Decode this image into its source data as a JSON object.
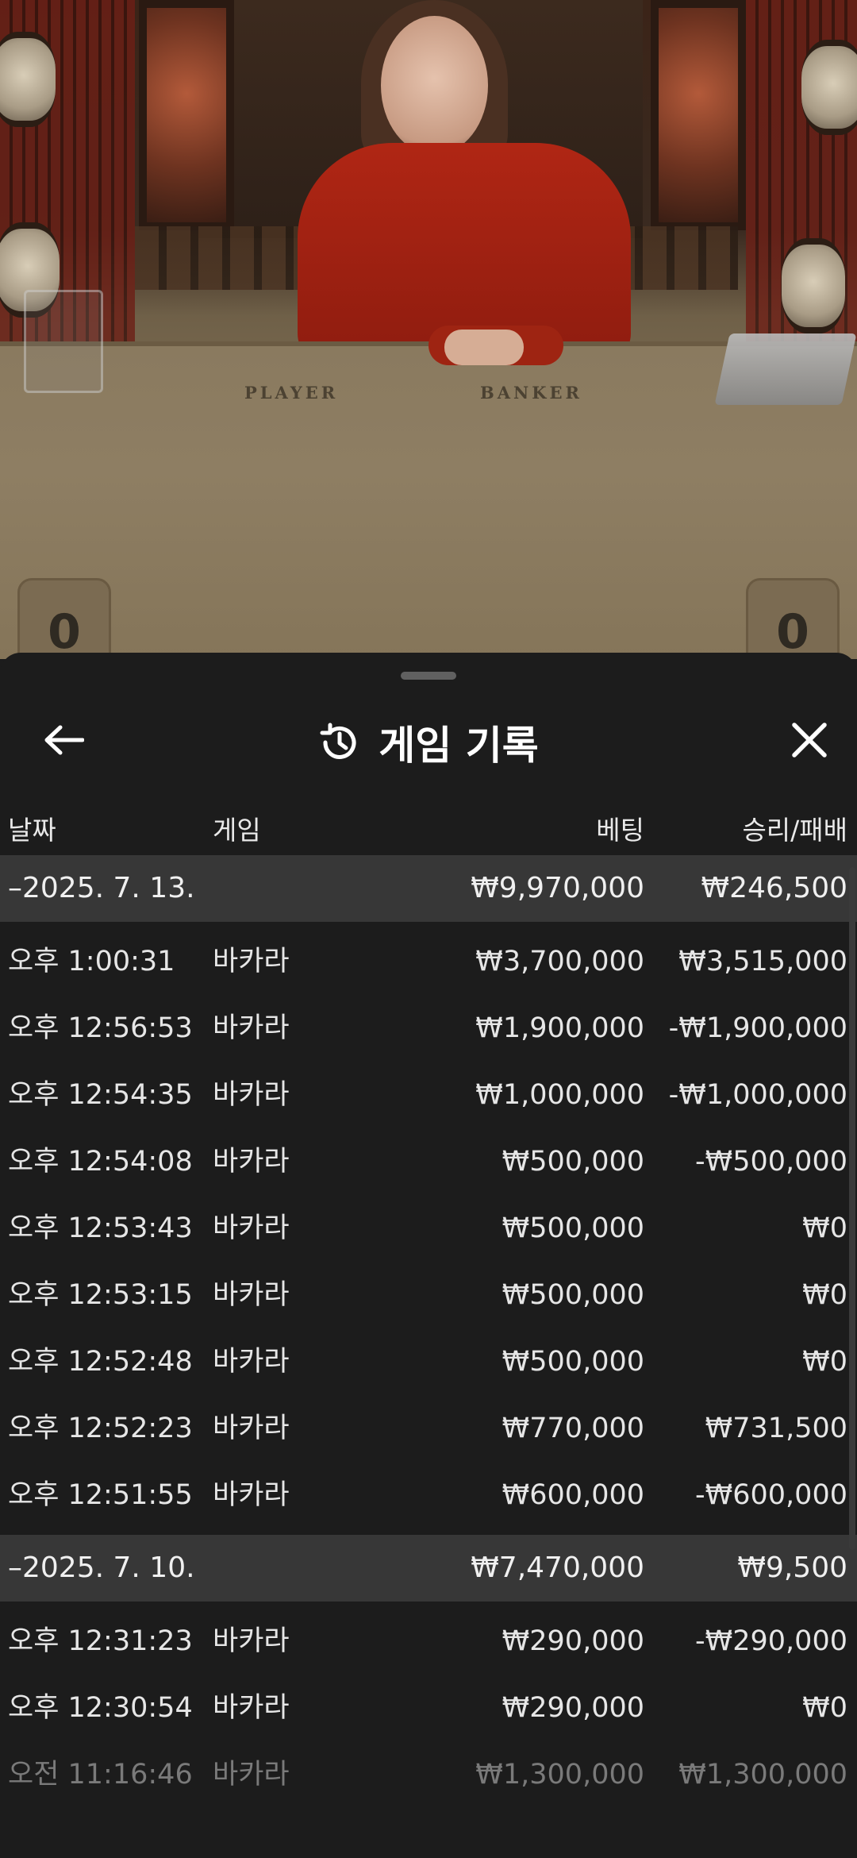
{
  "video": {
    "table_labels": [
      "PLAYER",
      "BANKER"
    ],
    "player_score": "0",
    "banker_score": "0"
  },
  "sheet": {
    "title": "게임 기록",
    "icons": {
      "back": "arrow-left-icon",
      "history": "history-icon",
      "close": "close-icon"
    },
    "columns": {
      "date": "날짜",
      "game": "게임",
      "bet": "베팅",
      "result": "승리/패배"
    },
    "groups": [
      {
        "date": "–2025. 7. 13.",
        "bet_total": "₩9,970,000",
        "result_total": "₩246,500",
        "rows": [
          {
            "time": "오후 1:00:31",
            "game": "바카라",
            "bet": "₩3,700,000",
            "result": "₩3,515,000"
          },
          {
            "time": "오후 12:56:53",
            "game": "바카라",
            "bet": "₩1,900,000",
            "result": "-₩1,900,000"
          },
          {
            "time": "오후 12:54:35",
            "game": "바카라",
            "bet": "₩1,000,000",
            "result": "-₩1,000,000"
          },
          {
            "time": "오후 12:54:08",
            "game": "바카라",
            "bet": "₩500,000",
            "result": "-₩500,000"
          },
          {
            "time": "오후 12:53:43",
            "game": "바카라",
            "bet": "₩500,000",
            "result": "₩0"
          },
          {
            "time": "오후 12:53:15",
            "game": "바카라",
            "bet": "₩500,000",
            "result": "₩0"
          },
          {
            "time": "오후 12:52:48",
            "game": "바카라",
            "bet": "₩500,000",
            "result": "₩0"
          },
          {
            "time": "오후 12:52:23",
            "game": "바카라",
            "bet": "₩770,000",
            "result": "₩731,500"
          },
          {
            "time": "오후 12:51:55",
            "game": "바카라",
            "bet": "₩600,000",
            "result": "-₩600,000"
          }
        ]
      },
      {
        "date": "–2025. 7. 10.",
        "bet_total": "₩7,470,000",
        "result_total": "₩9,500",
        "rows": [
          {
            "time": "오후 12:31:23",
            "game": "바카라",
            "bet": "₩290,000",
            "result": "-₩290,000"
          },
          {
            "time": "오후 12:30:54",
            "game": "바카라",
            "bet": "₩290,000",
            "result": "₩0"
          },
          {
            "time": "오전 11:16:46",
            "game": "바카라",
            "bet": "₩1,300,000",
            "result": "₩1,300,000"
          }
        ]
      }
    ]
  }
}
